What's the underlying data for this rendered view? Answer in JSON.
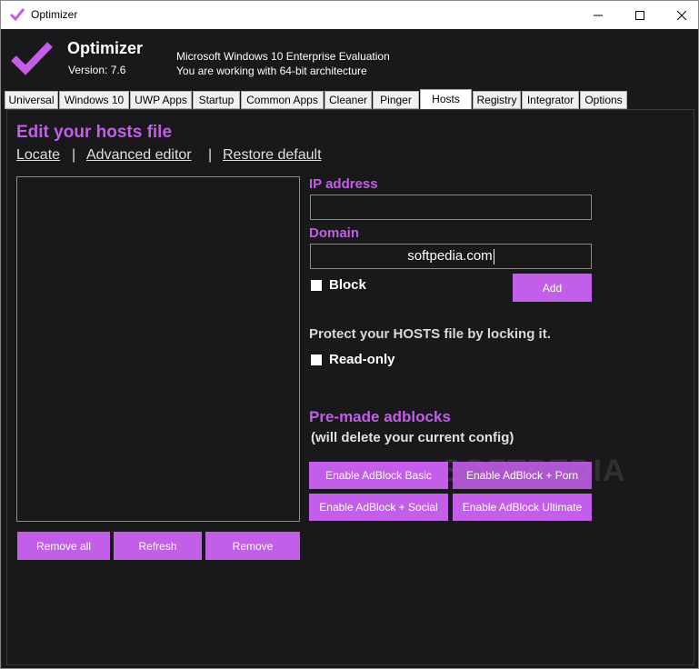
{
  "window": {
    "title": "Optimizer",
    "controls": {
      "minimize": "minimize",
      "maximize": "maximize",
      "close": "close"
    }
  },
  "header": {
    "app_name": "Optimizer",
    "version": "Version: 7.6",
    "os_line": "Microsoft Windows 10 Enterprise Evaluation",
    "arch_line": "You are working with 64-bit architecture"
  },
  "tabs": [
    {
      "label": "Universal",
      "active": false
    },
    {
      "label": "Windows 10",
      "active": false
    },
    {
      "label": "UWP Apps",
      "active": false
    },
    {
      "label": "Startup",
      "active": false
    },
    {
      "label": "Common Apps",
      "active": false
    },
    {
      "label": "Cleaner",
      "active": false
    },
    {
      "label": "Pinger",
      "active": false
    },
    {
      "label": "Hosts",
      "active": true
    },
    {
      "label": "Registry",
      "active": false
    },
    {
      "label": "Integrator",
      "active": false
    },
    {
      "label": "Options",
      "active": false
    }
  ],
  "hosts": {
    "title": "Edit your hosts file",
    "links": {
      "locate": "Locate",
      "separator": "|",
      "advanced_editor": "Advanced editor",
      "restore_default": "Restore default"
    },
    "list_items": [],
    "list_buttons": {
      "remove_all": "Remove all",
      "refresh": "Refresh",
      "remove": "Remove"
    },
    "ip_label": "IP address",
    "ip_value": "",
    "domain_label": "Domain",
    "domain_value": "softpedia.com",
    "block_label": "Block",
    "block_checked": false,
    "add_button": "Add",
    "protect_text": "Protect your HOSTS file by locking it.",
    "readonly_label": "Read-only",
    "readonly_checked": false,
    "adblocks_title": "Pre-made adblocks",
    "adblocks_subtitle": "(will delete your current config)",
    "adblock_buttons": {
      "basic": "Enable AdBlock Basic",
      "porn": "Enable AdBlock + Porn",
      "social": "Enable AdBlock + Social",
      "ultimate": "Enable AdBlock Ultimate"
    }
  },
  "watermark": "SOFTPEDIA",
  "colors": {
    "accent": "#c25ee8",
    "background": "#19181a",
    "text": "#ffffff"
  }
}
